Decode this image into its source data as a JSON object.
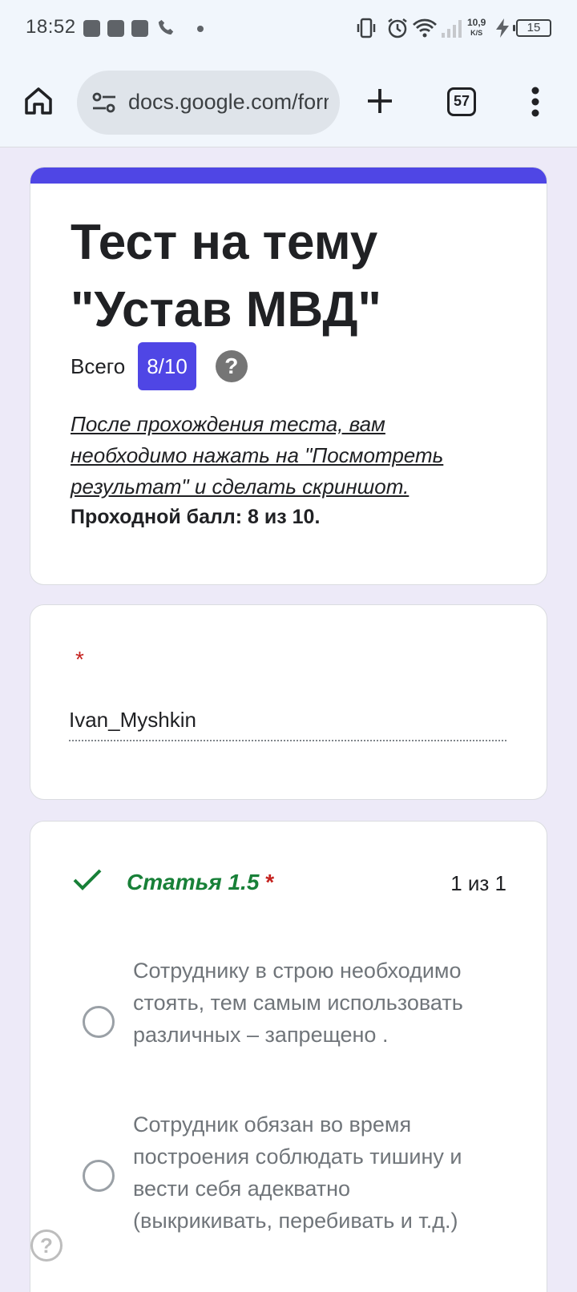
{
  "status_bar": {
    "time": "18:52",
    "net_speed_value": "10,9",
    "net_speed_unit": "K/S",
    "battery": "15"
  },
  "browser": {
    "url": "docs.google.com/forms",
    "tab_count": "57"
  },
  "form": {
    "title": "Тест на тему \"Устав МВД\"",
    "score_label": "Всего",
    "score_value": "8/10",
    "help_symbol": "?",
    "description": "После прохождения теста, вам необходимо нажать на \"Посмотреть результат\" и сделать скриншот.",
    "passing_score": "Проходной балл: 8 из 10."
  },
  "name_question": {
    "required_mark": "*",
    "answer": "Ivan_Myshkin"
  },
  "question": {
    "title": "Статья 1.5",
    "required_mark": "*",
    "score": "1 из 1",
    "options": [
      "Сотруднику в строю необходимо стоять, тем самым использовать различных – запрещено .",
      "Сотрудник обязан во время построения соблюдать тишину и вести себя адекватно (выкрикивать, перебивать и т.д.)"
    ]
  },
  "help_fab": "?",
  "colors": {
    "accent": "#4f46e5",
    "correct": "#188038",
    "required": "#c5221f",
    "page_background": "#edeaf8"
  },
  "icons": [
    "home-icon",
    "tune-icon",
    "plus-icon",
    "tabs-icon",
    "more-vert-icon",
    "check-icon",
    "help-icon",
    "wifi-icon",
    "alarm-icon",
    "vibrate-icon",
    "signal-icon",
    "charging-icon",
    "call-icon"
  ]
}
